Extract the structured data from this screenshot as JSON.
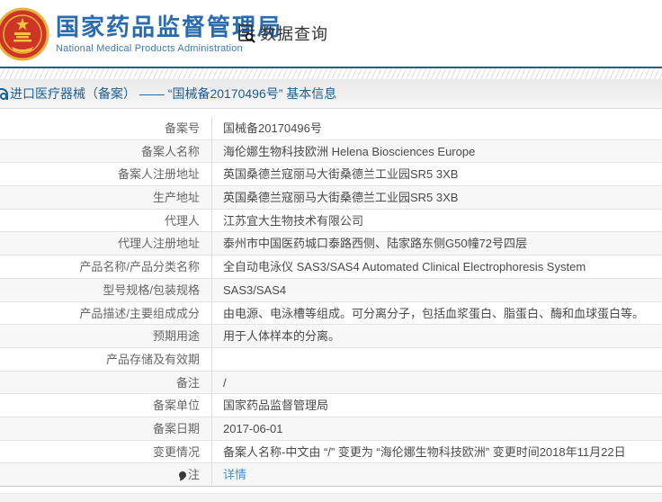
{
  "header": {
    "org_name_cn": "国家药品监督管理局",
    "org_name_en": "National Medical Products Administration",
    "data_query_label": "数据查询"
  },
  "breadcrumb": {
    "text": "进口医疗器械（备案） —— “国械备20170496号” 基本信息"
  },
  "table": {
    "rows": [
      {
        "label": "备案号",
        "value": "国械备20170496号"
      },
      {
        "label": "备案人名称",
        "value": "海伦娜生物科技欧洲 Helena Biosciences Europe"
      },
      {
        "label": "备案人注册地址",
        "value": "英国桑德兰寇丽马大街桑德兰工业园SR5 3XB"
      },
      {
        "label": "生产地址",
        "value": "英国桑德兰寇丽马大街桑德兰工业园SR5 3XB"
      },
      {
        "label": "代理人",
        "value": "江苏宜大生物技术有限公司"
      },
      {
        "label": "代理人注册地址",
        "value": "泰州市中国医药城口泰路西侧、陆家路东侧G50幢72号四层"
      },
      {
        "label": "产品名称/产品分类名称",
        "value": "全自动电泳仪 SAS3/SAS4 Automated Clinical Electrophoresis System"
      },
      {
        "label": "型号规格/包装规格",
        "value": "SAS3/SAS4"
      },
      {
        "label": "产品描述/主要组成成分",
        "value": "由电源、电泳槽等组成。可分离分子，包括血浆蛋白、脂蛋白、酶和血球蛋白等。"
      },
      {
        "label": "预期用途",
        "value": "用于人体样本的分离。"
      },
      {
        "label": "产品存储及有效期",
        "value": ""
      },
      {
        "label": "备注",
        "value": "/"
      },
      {
        "label": "备案单位",
        "value": "国家药品监督管理局"
      },
      {
        "label": "备案日期",
        "value": "2017-06-01"
      },
      {
        "label": "变更情况",
        "value": "备案人名称-中文由 “/” 变更为 “海伦娜生物科技欧洲” 变更时间2018年11月22日"
      },
      {
        "label": "注",
        "value": "详情",
        "is_link": true,
        "pin_icon": true
      }
    ]
  },
  "colors": {
    "brand_blue": "#2a6bb0",
    "header_border": "#15618e",
    "breadcrumb_text": "#1a5e96",
    "link_blue": "#3e8ed6",
    "label_text": "#666666",
    "value_text": "#4a4a4a",
    "row_alt_bg": "#f7f7f7",
    "row_border": "#e3e3e3"
  }
}
